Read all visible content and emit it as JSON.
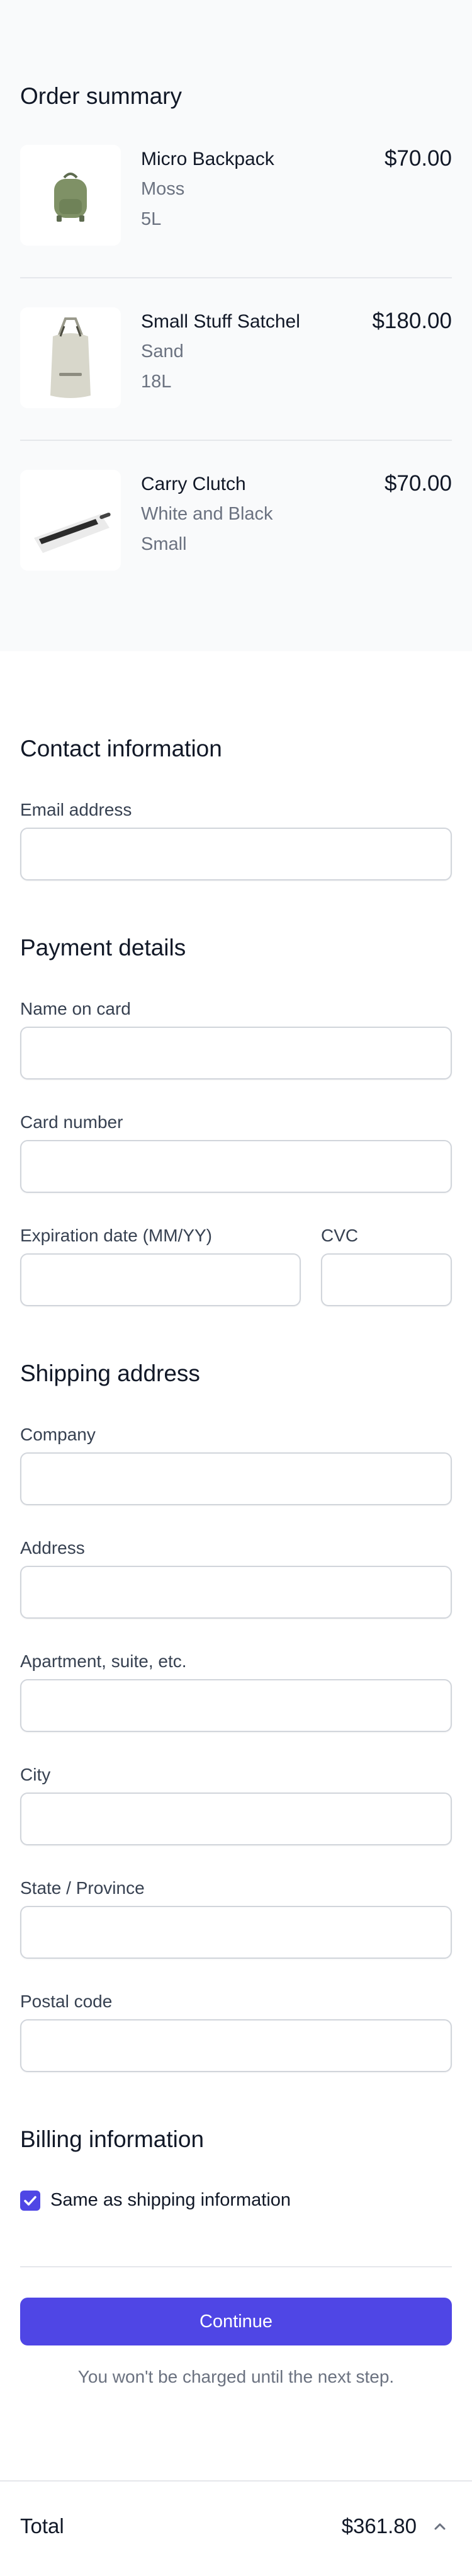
{
  "order_summary": {
    "title": "Order summary",
    "products": [
      {
        "name": "Micro Backpack",
        "color": "Moss",
        "size": "5L",
        "price": "$70.00",
        "image": "backpack-image"
      },
      {
        "name": "Small Stuff Satchel",
        "color": "Sand",
        "size": "18L",
        "price": "$180.00",
        "image": "satchel-image"
      },
      {
        "name": "Carry Clutch",
        "color": "White and Black",
        "size": "Small",
        "price": "$70.00",
        "image": "clutch-image"
      }
    ]
  },
  "contact": {
    "title": "Contact information",
    "email_label": "Email address",
    "email_value": ""
  },
  "payment": {
    "title": "Payment details",
    "name_label": "Name on card",
    "card_label": "Card number",
    "expiration_label": "Expiration date (MM/YY)",
    "cvc_label": "CVC"
  },
  "shipping": {
    "title": "Shipping address",
    "company_label": "Company",
    "address_label": "Address",
    "apartment_label": "Apartment, suite, etc.",
    "city_label": "City",
    "state_label": "State / Province",
    "postal_label": "Postal code"
  },
  "billing": {
    "title": "Billing information",
    "same_as_shipping_label": "Same as shipping information",
    "same_as_shipping_checked": true
  },
  "actions": {
    "continue_label": "Continue",
    "note": "You won't be charged until the next step."
  },
  "total": {
    "label": "Total",
    "value": "$361.80",
    "toggle_icon": "chevron-up-icon"
  },
  "colors": {
    "accent": "#4f46e5",
    "summary_background": "#f9fafb",
    "border": "#d1d5db",
    "muted_text": "#6b7280"
  }
}
